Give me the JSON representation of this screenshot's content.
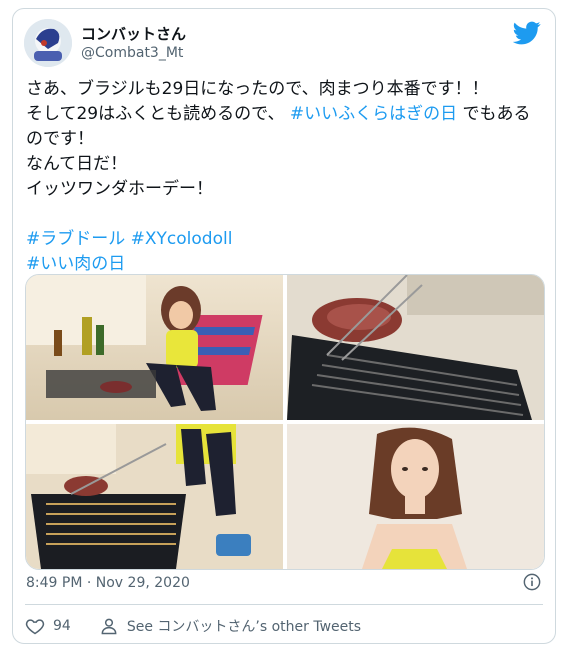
{
  "author": {
    "display_name": "コンバットさん",
    "handle": "@Combat3_Mt",
    "avatar": "avatar-image"
  },
  "brand_icon": "twitter-bird-icon",
  "tweet": {
    "segments": [
      {
        "text": "さあ、ブラジルも29日になったので、肉まつり本番です！！\nそして29はふくとも読めるので、 ",
        "link": false
      },
      {
        "text": "#いいふくらはぎの日",
        "link": true
      },
      {
        "text": " でもあるのです！\nなんて日だ！\nイッツワンダホーデー！\n\n",
        "link": false
      },
      {
        "text": "#ラブドール",
        "link": true
      },
      {
        "text": " ",
        "link": false
      },
      {
        "text": "#XYcolodoll",
        "link": true
      },
      {
        "text": "\n",
        "link": false
      },
      {
        "text": "#いい肉の日",
        "link": true
      }
    ]
  },
  "media": {
    "images": [
      {
        "name": "photo-doll-sitting-grill"
      },
      {
        "name": "photo-meat-on-grill"
      },
      {
        "name": "photo-grill-closeup"
      },
      {
        "name": "photo-doll-portrait"
      }
    ]
  },
  "meta": {
    "timestamp": "8:49 PM · Nov 29, 2020",
    "info_icon": "info-icon"
  },
  "actions": {
    "like_icon": "heart-icon",
    "like_count": "94",
    "profile_icon": "person-icon",
    "see_other": "See コンバットさん’s other Tweets"
  },
  "colors": {
    "link": "#1d9bf0",
    "border": "#cfd9de",
    "secondary_text": "#536471",
    "twitter_blue": "#1d9bf0"
  }
}
